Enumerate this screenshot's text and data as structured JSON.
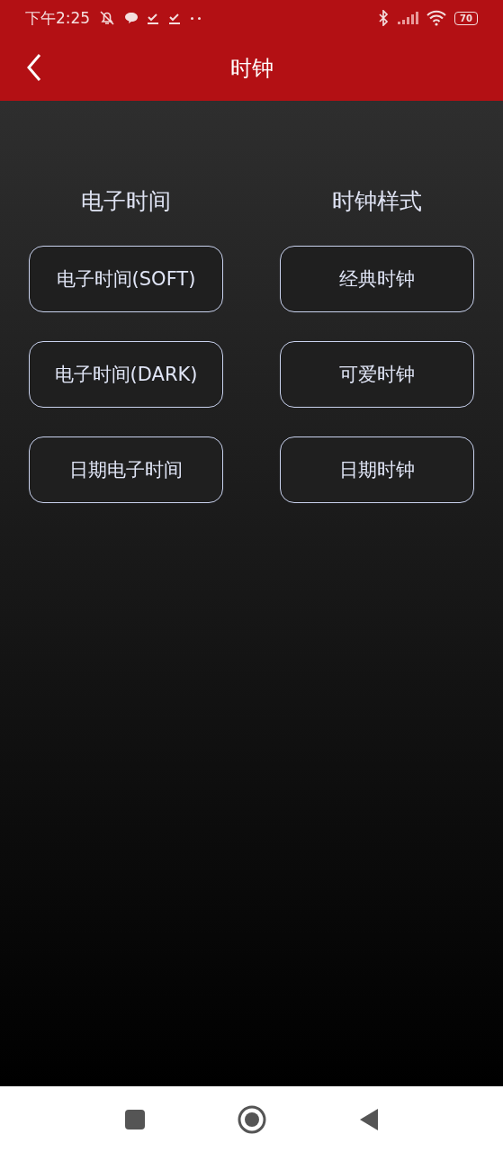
{
  "status_bar": {
    "time": "下午2:25",
    "battery": "70"
  },
  "app_bar": {
    "title": "时钟"
  },
  "columns": [
    {
      "heading": "电子时间",
      "buttons": [
        "电子时间(SOFT)",
        "电子时间(DARK)",
        "日期电子时间"
      ]
    },
    {
      "heading": "时钟样式",
      "buttons": [
        "经典时钟",
        "可爱时钟",
        "日期时钟"
      ]
    }
  ]
}
